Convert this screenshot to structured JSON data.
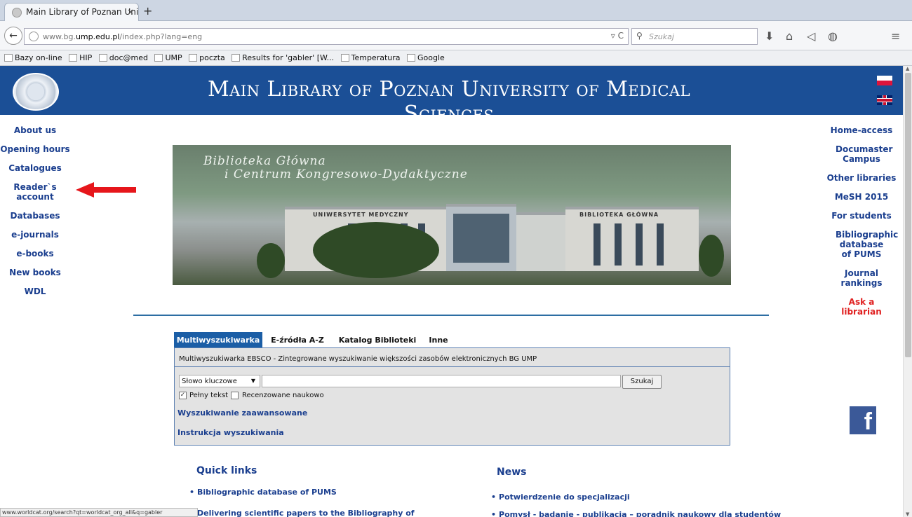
{
  "browser": {
    "tab_title": "Main Library of Poznan Uni...",
    "tab_close": "×",
    "new_tab": "+",
    "url_prefix": "www.bg.",
    "url_domain": "ump.edu.pl",
    "url_suffix": "/index.php?lang=eng",
    "url_tools": "▿ C",
    "search_placeholder": "Szukaj",
    "bookmarks": [
      {
        "label": "Bazy on-line"
      },
      {
        "label": "HIP"
      },
      {
        "label": "doc@med"
      },
      {
        "label": "UMP"
      },
      {
        "label": "poczta"
      },
      {
        "label": "Results for 'gabler' [W..."
      },
      {
        "label": "Temperatura"
      },
      {
        "label": "Google"
      }
    ]
  },
  "header": {
    "title": "Main Library of Poznan University of Medical Sciences",
    "flag_pl": "Polish",
    "flag_en": "English"
  },
  "left_nav": [
    "About us",
    "Opening hours",
    "Catalogues",
    "Reader`s account",
    "Databases",
    "e-journals",
    "e-books",
    "New books",
    "WDL"
  ],
  "right_nav": [
    "Home-access",
    "Documaster Campus",
    "Other libraries",
    "MeSH 2015",
    "For students",
    "Bibliographic database of PUMS",
    "Journal rankings",
    "Ask a librarian"
  ],
  "photo": {
    "line1": "Biblioteka Główna",
    "line2": "i Centrum Kongresowo-Dydaktyczne",
    "sign_left": "UNIWERSYTET MEDYCZNY",
    "sign_right": "BIBLIOTEKA GŁÓWNA"
  },
  "search": {
    "tabs": [
      "Multiwyszukiwarka",
      "E-źródła A-Z",
      "Katalog Biblioteki",
      "Inne"
    ],
    "description": "Multiwyszukiwarka EBSCO - Zintegrowane wyszukiwanie większości zasobów elektronicznych BG UMP",
    "select_value": "Słowo kluczowe",
    "button": "Szukaj",
    "check_fulltext": "Pełny tekst",
    "check_peer": "Recenzowane naukowo",
    "advanced_link": "Wyszukiwanie zaawansowane",
    "help_link": "Instrukcja wyszukiwania"
  },
  "quick_links": {
    "heading": "Quick links",
    "items": [
      "Bibliographic database of PUMS",
      "Delivering scientific papers to the Bibliography of"
    ]
  },
  "news": {
    "heading": "News",
    "items": [
      "Potwierdzenie do specjalizacji",
      "Pomysł - badanie - publikacja – poradnik naukowy dla studentów"
    ]
  },
  "status_bar": "www.worldcat.org/search?qt=worldcat_org_all&q=gabler",
  "facebook": "f",
  "colors": {
    "banner": "#1b4f96",
    "link": "#1b3f8f",
    "accent_red": "#e02020"
  }
}
